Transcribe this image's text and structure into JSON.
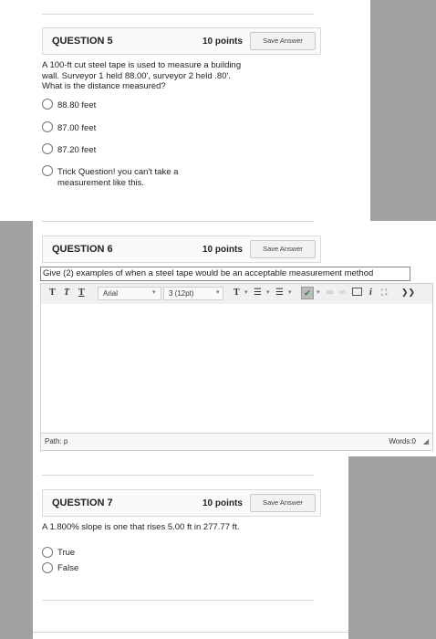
{
  "q5": {
    "title": "QUESTION 5",
    "points": "10 points",
    "save_label": "Save Answer",
    "text": "A 100-ft cut steel tape is used to measure a building wall. Surveyor 1 held 88.00', surveyor 2 held .80'. What is the distance measured?",
    "options": [
      "88.80 feet",
      "87.00 feet",
      "87.20 feet",
      "Trick Question! you can't take a measurement like this."
    ]
  },
  "q6": {
    "title": "QUESTION 6",
    "points": "10 points",
    "save_label": "Save Answer",
    "text": "Give (2) examples of when a steel tape would be an acceptable measurement method",
    "editor": {
      "font_name": "Arial",
      "font_size": "3 (12pt)",
      "path_label": "Path: p",
      "words_label": "Words:0"
    }
  },
  "q7": {
    "title": "QUESTION 7",
    "points": "10 points",
    "save_label": "Save Answer",
    "text": "A 1.800% slope is one that rises 5.00 ft in 277.77 ft.",
    "options": [
      "True",
      "False"
    ]
  }
}
